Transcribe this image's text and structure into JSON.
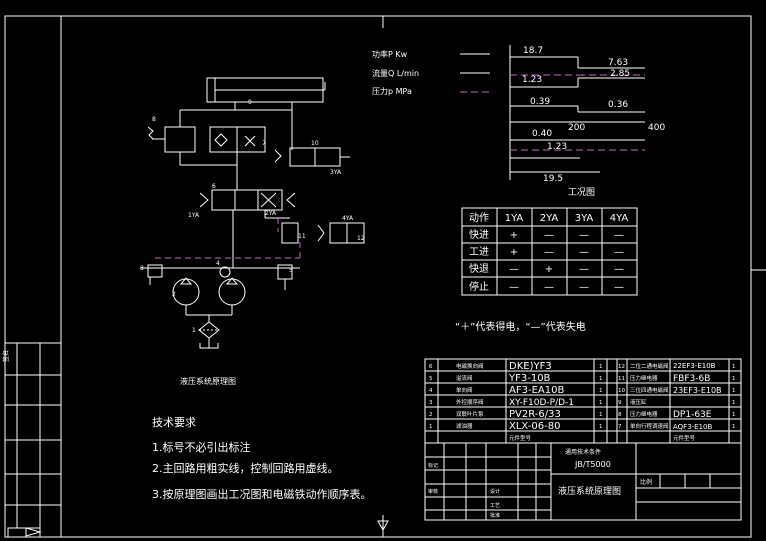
{
  "legend": {
    "power": "功率P Kw",
    "flow": "流量Q L/min",
    "pressure": "压力p MPa"
  },
  "chart": {
    "p1": "18.7",
    "p2": "7.63",
    "p3": "2.85",
    "q1": "1.23",
    "q2": "0.39",
    "q3": "0.36",
    "x1": "200",
    "x2": "400",
    "y1": "0.40",
    "r1": "1.23",
    "r2": "19.5",
    "caption": "工况图"
  },
  "sol_table": {
    "headers": [
      "动作",
      "1YA",
      "2YA",
      "3YA",
      "4YA"
    ],
    "rows": [
      [
        "快进",
        "+",
        "—",
        "—",
        "—"
      ],
      [
        "工进",
        "+",
        "—",
        "—",
        "—"
      ],
      [
        "快退",
        "—",
        "+",
        "—",
        "—"
      ],
      [
        "停止",
        "—",
        "—",
        "—",
        "—"
      ]
    ],
    "note": "“＋”代表得电，“—”代表失电"
  },
  "schematic": {
    "caption": "液压系统原理图",
    "labels": [
      "9",
      "8",
      "7",
      "10",
      "3YA",
      "6",
      "1YA",
      "2YA",
      "11",
      "4YA",
      "12",
      "3",
      "4",
      "5",
      "2",
      "1"
    ]
  },
  "tech": {
    "title": "技术要求",
    "items": [
      "1.标号不必引出标注",
      "2.主回路用粗实线，控制回路用虚线。",
      "3.按原理图画出工况图和电磁铁动作顺序表。"
    ]
  },
  "bom": {
    "rows": [
      [
        "6",
        "电磁换向阀",
        "DKE)YF3",
        "1",
        "12",
        "二位二通电磁阀",
        "22EF3-E10B",
        "1"
      ],
      [
        "5",
        "溢流阀",
        "YF3-10B",
        "1",
        "11",
        "压力继电器",
        "FBF3-6B",
        "1"
      ],
      [
        "4",
        "单向阀",
        "AF3-EA10B",
        "1",
        "10",
        "三位四通电磁阀",
        "23EF3-E10B",
        "1"
      ],
      [
        "3",
        "外控顺序阀",
        "XY-F10D-P/D-1",
        "1",
        "9",
        "液压缸",
        "",
        "1"
      ],
      [
        "2",
        "双联叶片泵",
        "PV2R-6/33",
        "1",
        "8",
        "压力继电器",
        "DP1-63E",
        "1"
      ],
      [
        "1",
        "滤油器",
        "XLX-06-80",
        "1",
        "7",
        "单向行程调速阀",
        "AQF3-E10B",
        "1"
      ]
    ],
    "footer_left": "元件型号",
    "footer_right": "元件型号"
  },
  "title_block": {
    "std_label": "通用技术条件",
    "std": "JB/T5000",
    "title": "液压系统原理图",
    "scale": "比例",
    "check": "审核",
    "design": "设计",
    "process": "工艺",
    "approve": "批准",
    "mark": "标记"
  },
  "side": {
    "label": "签名"
  }
}
